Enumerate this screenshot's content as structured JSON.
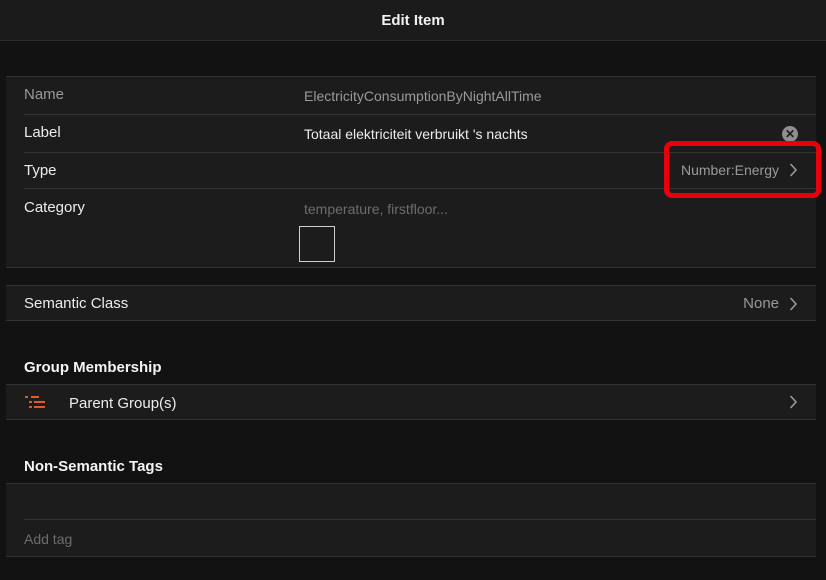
{
  "navbar": {
    "title": "Edit Item"
  },
  "fields": {
    "name": {
      "label": "Name",
      "value": "ElectricityConsumptionByNightAllTime"
    },
    "item_label": {
      "label": "Label",
      "value": "Totaal elektriciteit verbruikt 's nachts"
    },
    "type": {
      "label": "Type",
      "value": "Number:Energy"
    },
    "category": {
      "label": "Category",
      "placeholder": "temperature, firstfloor..."
    }
  },
  "semantic": {
    "label": "Semantic Class",
    "value": "None"
  },
  "group_membership": {
    "title": "Group Membership",
    "parent_groups_label": "Parent Group(s)"
  },
  "tags": {
    "title": "Non-Semantic Tags",
    "add_placeholder": "Add tag"
  },
  "colors": {
    "highlight": "#e8000b",
    "accent_icon": "#e05a2a"
  },
  "icons": {
    "clear": "clear-icon",
    "chevron": "chevron-right-icon",
    "group": "list-icon"
  }
}
